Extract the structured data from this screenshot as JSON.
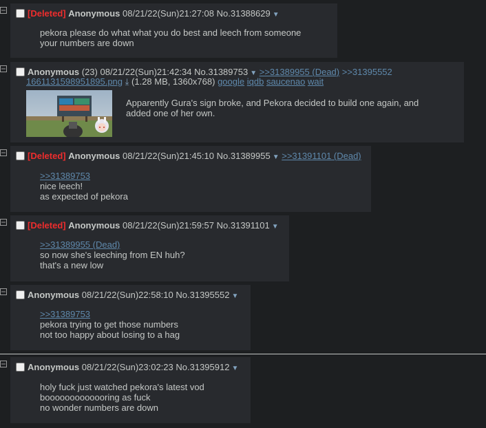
{
  "posts": [
    {
      "deleted": "[Deleted]",
      "name": "Anonymous",
      "age": "",
      "datetime": "08/21/22(Sun)21:27:08",
      "no": "No.31388629",
      "replies": [],
      "lines": [
        "pekora please do what what you do best and leech from someone",
        "your numbers are down"
      ]
    },
    {
      "deleted": "",
      "name": "Anonymous",
      "age": "(23)",
      "datetime": "08/21/22(Sun)21:42:34",
      "no": "No.31389753",
      "replies": [
        ">>31389955 (Dead)",
        ">>31395552"
      ],
      "file": {
        "name": "1661131598951895.png",
        "meta": "(1.28 MB, 1360x768)",
        "links": [
          "google",
          "iqdb",
          "saucenao",
          "wait"
        ]
      },
      "lines": [
        "Apparently Gura's sign broke, and Pekora decided to build one again, and",
        "added one of her own."
      ]
    },
    {
      "deleted": "[Deleted]",
      "name": "Anonymous",
      "age": "",
      "datetime": "08/21/22(Sun)21:45:10",
      "no": "No.31389955",
      "replies": [
        ">>31391101 (Dead)"
      ],
      "quote": ">>31389753",
      "lines": [
        "nice leech!",
        "as expected of pekora"
      ]
    },
    {
      "deleted": "[Deleted]",
      "name": "Anonymous",
      "age": "",
      "datetime": "08/21/22(Sun)21:59:57",
      "no": "No.31391101",
      "replies": [],
      "quote": ">>31389955 (Dead)",
      "lines": [
        "so now she's leeching from EN huh?",
        "that's a new low"
      ]
    },
    {
      "deleted": "",
      "name": "Anonymous",
      "age": "",
      "datetime": "08/21/22(Sun)22:58:10",
      "no": "No.31395552",
      "replies": [],
      "quote": ">>31389753",
      "lines": [
        "pekora trying to get those numbers",
        "not too happy about losing to a hag"
      ]
    },
    {
      "deleted": "",
      "name": "Anonymous",
      "age": "",
      "datetime": "08/21/22(Sun)23:02:23",
      "no": "No.31395912",
      "replies": [],
      "lines": [
        "holy fuck just watched pekora's latest vod",
        "booooooooooooring as fuck",
        "no wonder numbers are down"
      ]
    }
  ],
  "colors": {
    "background": "#1d1f21",
    "post": "#282a2e",
    "deleted": "#ee2d2d",
    "link": "#5f89ac",
    "text": "#c5c8c6"
  },
  "icons": {
    "side": "minus-square-icon",
    "menu": "chevron-down-icon",
    "download": "download-icon"
  }
}
